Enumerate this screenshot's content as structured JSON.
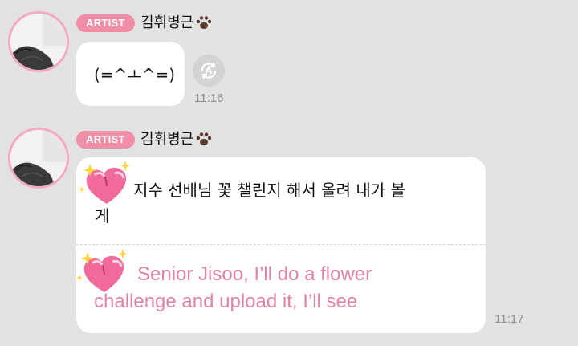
{
  "messages": [
    {
      "badge": "ARTIST",
      "sender": "김휘병근",
      "text": "(=^ㅗ^=)",
      "time": "11:16"
    },
    {
      "badge": "ARTIST",
      "sender": "김휘병근",
      "text_ko_line1": "지수 선배님 꽃 챌린지 해서 올려 내가 볼",
      "text_ko_line2": "게",
      "text_en_line1": "Senior Jisoo, I’ll do a flower",
      "text_en_line2": "challenge and upload it, I’ll see",
      "time": "11:17"
    }
  ],
  "colors": {
    "background": "#e2e2e2",
    "badge": "#ef8ea6",
    "avatar_ring": "#f4a9c2",
    "translation_text": "#e283a2"
  },
  "icons": [
    "paw-icon",
    "translate-icon",
    "peach-heart-sparkle-emoji"
  ]
}
